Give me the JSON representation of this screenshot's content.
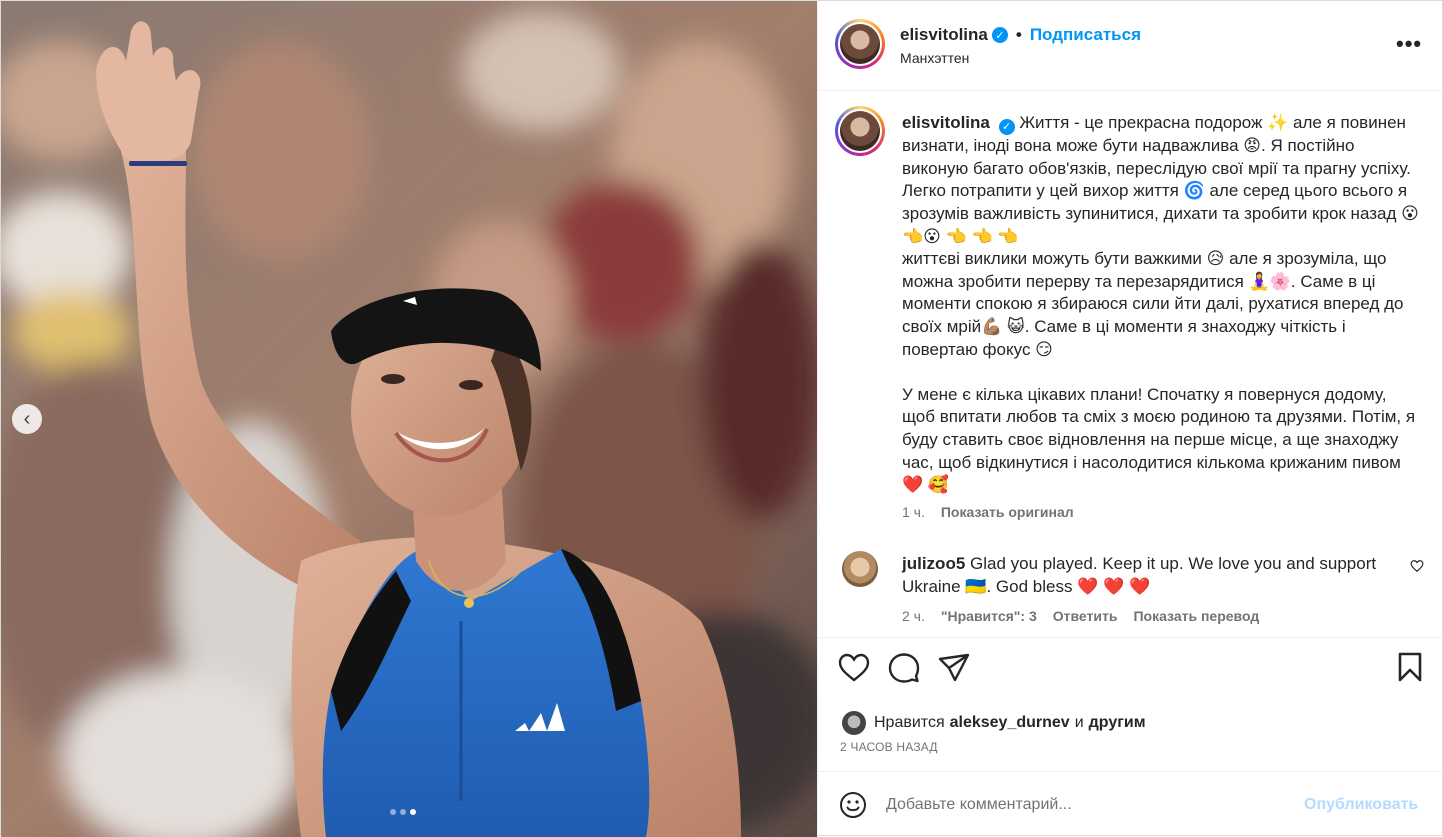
{
  "colors": {
    "accent": "#0095f6",
    "heart": "#ed4956",
    "muted": "#737373"
  },
  "header": {
    "username": "elisvitolina",
    "separator": "•",
    "follow_label": "Подписаться",
    "location": "Манхэттен",
    "more_icon": "more-horizontal-icon"
  },
  "caption": {
    "username": "elisvitolina",
    "text": "Життя - це прекрасна подорож ✨ але я повинен визнати, іноді вона може бути надважлива 😡. Я постійно виконую багато обов'язків, переслідую свої мрії та прагну успіху. Легко потрапити у цей вихор життя 🌀 але серед цього всього я зрозумів важливість зупинитися, дихати та зробити крок назад 😮 👈😮 👈 👈 👈\nжиттєві виклики можуть бути важкими 😥 але я зрозуміла, що можна зробити перерву та перезарядитися 🧘‍♀️🌸. Саме в ці моменти спокою я збираюся сили йти далі, рухатися вперед до своїх мрій💪🏽 😺. Саме в ці моменти я знаходжу чіткість і повертаю фокус 😏\n\nУ мене є кілька цікавих плани! Спочатку я повернуся додому, щоб впитати любов та сміх з моєю родиною та друзями. Потім, я буду ставить своє відновлення на перше місце, а ще знаходжу час, щоб відкинутися і насолодитися кількома крижаним пивом ❤️ 🥰",
    "time": "1 ч.",
    "show_original": "Показать оригинал"
  },
  "comment": {
    "username": "julizoo5",
    "text": "Glad you played. Keep it up. We love you and support Ukraine 🇺🇦. God bless ❤️ ❤️ ❤️",
    "time": "2 ч.",
    "likes": "\"Нравится\": 3",
    "reply": "Ответить",
    "translate": "Показать перевод"
  },
  "actions": {
    "like_icon": "heart-icon",
    "comment_icon": "comment-icon",
    "share_icon": "share-icon",
    "save_icon": "bookmark-icon"
  },
  "likes": {
    "prefix": "Нравится",
    "user": "aleksey_durnev",
    "conj": "и",
    "others": "другим"
  },
  "posted": "2 ЧАСОВ НАЗАД",
  "add_comment": {
    "emoji_icon": "smiley-icon",
    "placeholder": "Добавьте комментарий...",
    "post_label": "Опубликовать"
  },
  "carousel": {
    "total": 3,
    "current": 3
  }
}
